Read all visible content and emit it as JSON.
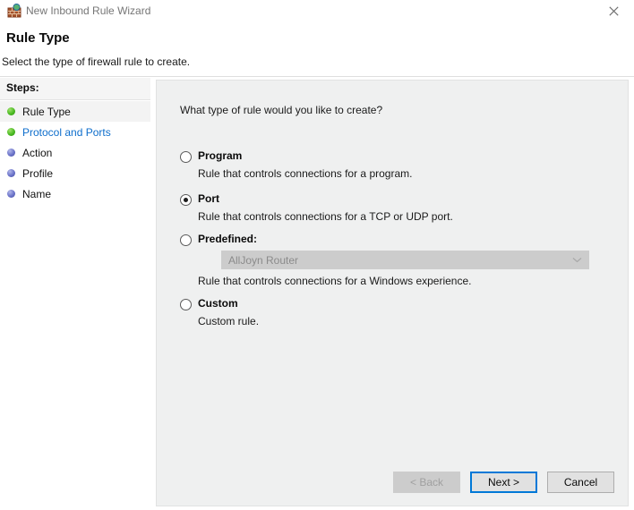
{
  "window": {
    "title": "New Inbound Rule Wizard",
    "title_icon": "firewall-globe-icon",
    "close_label": "Close"
  },
  "header": {
    "title": "Rule Type",
    "subtitle": "Select the type of firewall rule to create."
  },
  "sidebar": {
    "heading": "Steps:",
    "items": [
      {
        "label": "Rule Type",
        "state": "current",
        "bullet": "green"
      },
      {
        "label": "Protocol and Ports",
        "state": "link",
        "bullet": "green"
      },
      {
        "label": "Action",
        "state": "pending",
        "bullet": "blue"
      },
      {
        "label": "Profile",
        "state": "pending",
        "bullet": "blue"
      },
      {
        "label": "Name",
        "state": "pending",
        "bullet": "blue"
      }
    ]
  },
  "main": {
    "question": "What type of rule would you like to create?",
    "options": [
      {
        "title": "Program",
        "description": "Rule that controls connections for a program.",
        "selected": false
      },
      {
        "title": "Port",
        "description": "Rule that controls connections for a TCP or UDP port.",
        "selected": true
      },
      {
        "title": "Predefined:",
        "description": "Rule that controls connections for a Windows experience.",
        "selected": false,
        "combo_value": "AllJoyn Router",
        "combo_disabled": true
      },
      {
        "title": "Custom",
        "description": "Custom rule.",
        "selected": false
      }
    ]
  },
  "footer": {
    "back_label": "< Back",
    "next_label": "Next >",
    "cancel_label": "Cancel"
  },
  "colors": {
    "accent": "#0078d7",
    "link": "#0e6ecc",
    "panel_bg": "#eff0f0",
    "step_done": "#4aba22",
    "step_pending": "#6b73c9"
  }
}
